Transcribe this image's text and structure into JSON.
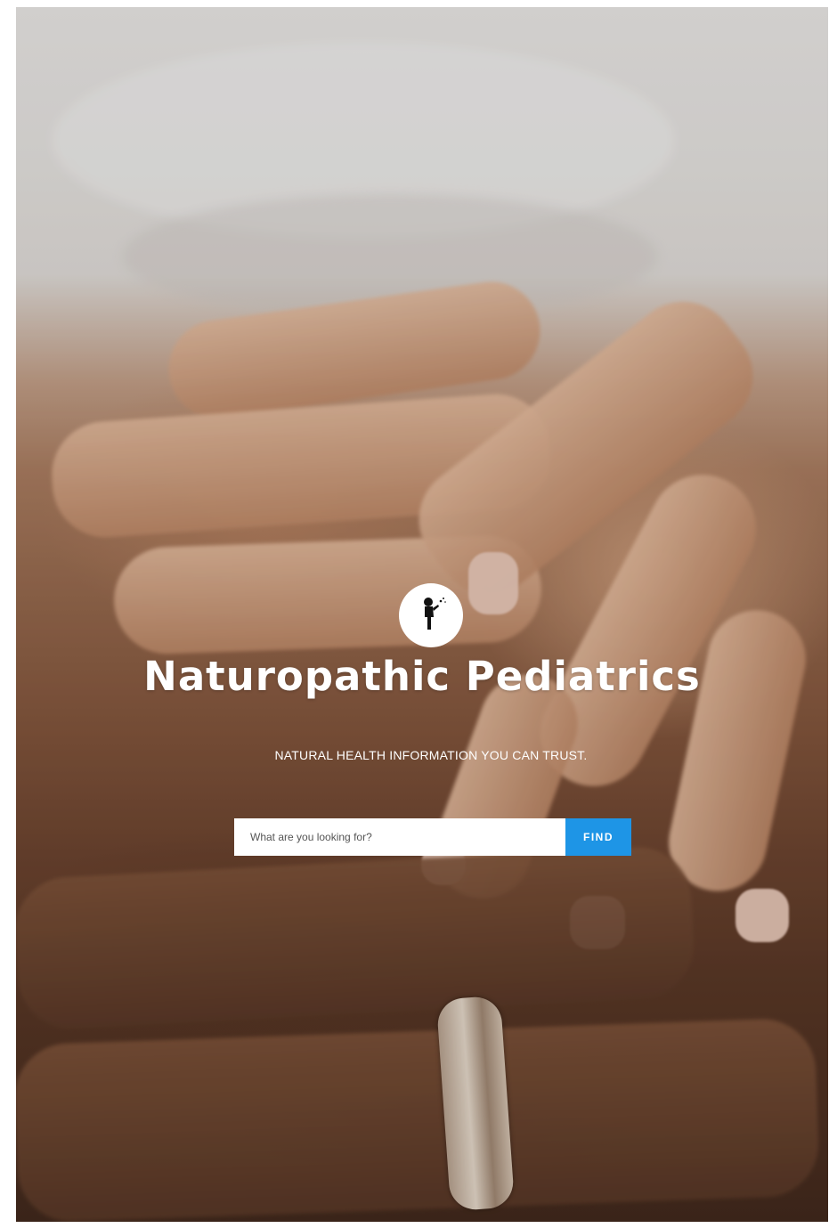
{
  "hero": {
    "background_description_icon": "hands-photo-background",
    "logo_icon": "child-silhouette-icon"
  },
  "site": {
    "title": "Naturopathic Pediatrics",
    "tagline": "NATURAL HEALTH INFORMATION YOU CAN TRUST."
  },
  "search": {
    "placeholder": "What are you looking for?",
    "value": "",
    "button_label": "FIND"
  },
  "colors": {
    "accent": "#1e95e6",
    "text_on_hero": "#ffffff"
  }
}
